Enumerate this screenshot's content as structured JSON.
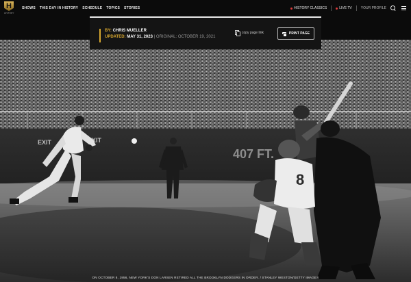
{
  "logo": {
    "letter": "H",
    "wordmark": "HISTORY"
  },
  "nav": {
    "links": [
      "SHOWS",
      "THIS DAY IN HISTORY",
      "SCHEDULE",
      "TOPICS",
      "STORIES"
    ],
    "right": {
      "classics": "HISTORY CLASSICS",
      "live": "LIVE TV",
      "profile": "YOUR PROFILE"
    }
  },
  "byline": {
    "author_prefix": "BY: ",
    "author": "CHRIS MUELLER",
    "updated_prefix": "UPDATED: ",
    "updated": "MAY 31, 2023",
    "original": " | ORIGINAL: OCTOBER 19, 2021",
    "copy_link": "copy page link",
    "print": "PRINT PAGE"
  },
  "photo": {
    "wall_text_left": "EXIT",
    "wall_text_exit2": "EXIT",
    "wall_text_right": "407 FT.",
    "jersey_number": "8",
    "caption": "ON OCTOBER 8, 1956, NEW YORK'S DON LARSEN RETIRED ALL THE BROOKLYN DODGERS IN ORDER. / STANLEY WESTON/GETTY IMAGES"
  },
  "colors": {
    "accent": "#d9a930",
    "live_dot": "#e23b3b",
    "background": "#0b0b0b"
  }
}
